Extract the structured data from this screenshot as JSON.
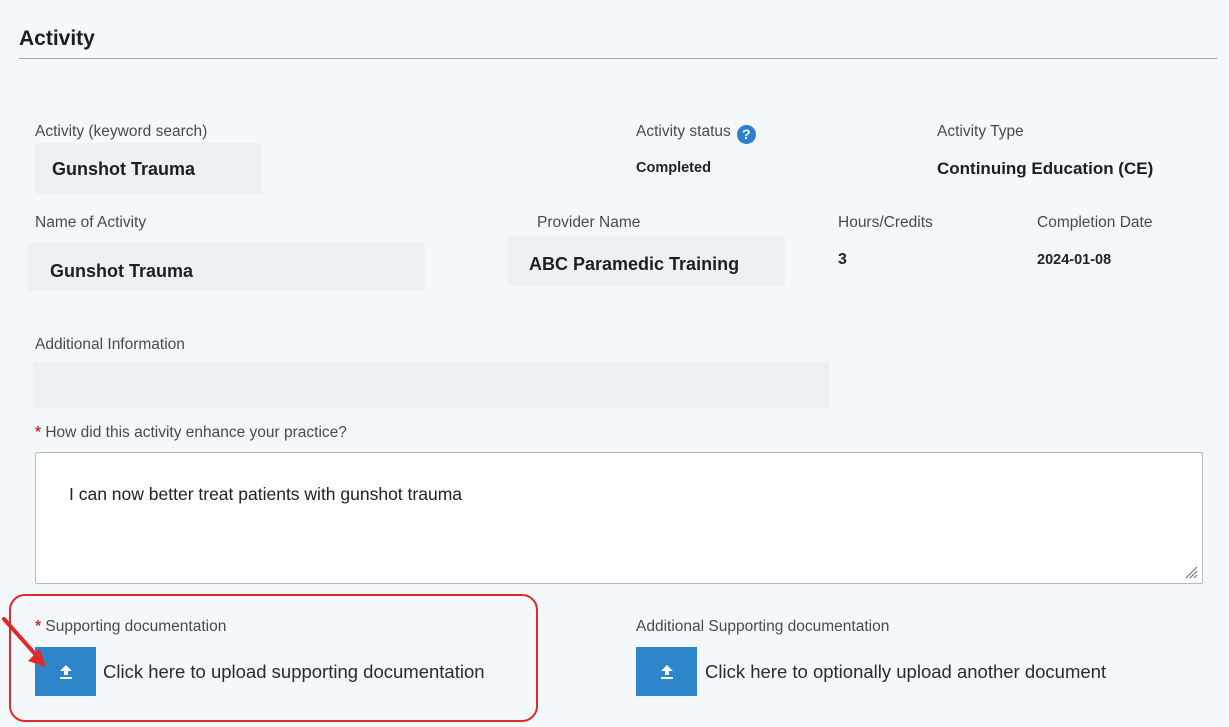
{
  "section": {
    "title": "Activity"
  },
  "activity_search": {
    "label": "Activity (keyword search)",
    "value": "Gunshot Trauma"
  },
  "activity_status": {
    "label": "Activity status",
    "value": "Completed",
    "help_icon": "question-circle-icon"
  },
  "activity_type": {
    "label": "Activity Type",
    "value": "Continuing Education (CE)"
  },
  "name_of_activity": {
    "label": "Name of Activity",
    "value": "Gunshot Trauma"
  },
  "provider_name": {
    "label": "Provider Name",
    "value": "ABC Paramedic Training"
  },
  "hours_credits": {
    "label": "Hours/Credits",
    "value": "3"
  },
  "completion_date": {
    "label": "Completion Date",
    "value": "2024-01-08"
  },
  "additional_information": {
    "label": "Additional Information",
    "value": ""
  },
  "practice_enhancement": {
    "required_mark": "*",
    "label": "How did this activity enhance your practice?",
    "value": "I can now better treat patients with gunshot trauma"
  },
  "supporting_doc": {
    "required_mark": "*",
    "label": "Supporting documentation",
    "upload_text": "Click here to upload supporting documentation",
    "icon": "upload-icon"
  },
  "additional_supporting_doc": {
    "label": "Additional Supporting documentation",
    "upload_text": "Click here to optionally upload another document",
    "icon": "upload-icon"
  },
  "colors": {
    "accent": "#2c86c9",
    "required": "#d72c2c",
    "highlight": "#e02a2a",
    "background": "#f4f8fb"
  }
}
